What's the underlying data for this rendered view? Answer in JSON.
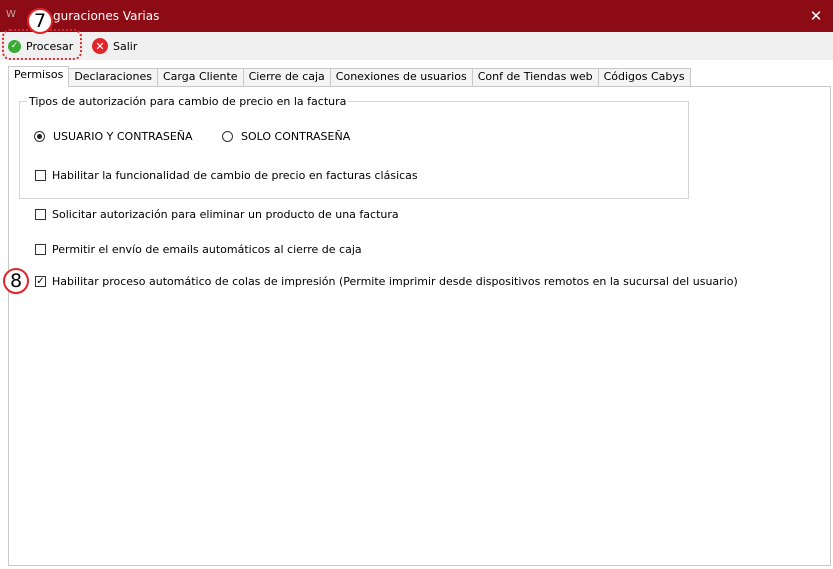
{
  "window": {
    "title": "guraciones Varias",
    "close_glyph": "✕",
    "icon_glyph": "W"
  },
  "toolbar": {
    "procesar_label": "Procesar",
    "salir_label": "Salir",
    "ok_glyph": "✓",
    "cancel_glyph": "✕"
  },
  "annotations": {
    "badge_7": "7",
    "badge_8": "8"
  },
  "tabs": [
    {
      "label": "Permisos",
      "active": true
    },
    {
      "label": "Declaraciones"
    },
    {
      "label": "Carga Cliente"
    },
    {
      "label": "Cierre de caja"
    },
    {
      "label": "Conexiones de usuarios"
    },
    {
      "label": "Conf de Tiendas web"
    },
    {
      "label": "Códigos Cabys"
    }
  ],
  "permisos": {
    "group_title": "Tipos de autorización para cambio de precio en la factura",
    "radio_user_pass": {
      "label": "USUARIO Y CONTRASEÑA",
      "selected": true
    },
    "radio_pass_only": {
      "label": "SOLO CONTRASEÑA",
      "selected": false
    },
    "chk_classic": {
      "label": "Habilitar la funcionalidad de cambio de precio en facturas clásicas",
      "checked": false
    },
    "chk_delete_product": {
      "label": "Solicitar autorización para eliminar un producto de una factura",
      "checked": false
    },
    "chk_emails": {
      "label": "Permitir el envío de emails automáticos al cierre de caja",
      "checked": false
    },
    "chk_print_queue": {
      "label": "Habilitar proceso automático de colas de impresión (Permite imprimir desde dispositivos remotos en la sucursal del usuario)",
      "checked": true
    },
    "check_glyph": "✓"
  },
  "colors": {
    "titlebar": "#8d0b14",
    "accent_annotation": "#e0262b",
    "ok_icon": "#3aa935",
    "cancel_icon": "#e0262b"
  }
}
